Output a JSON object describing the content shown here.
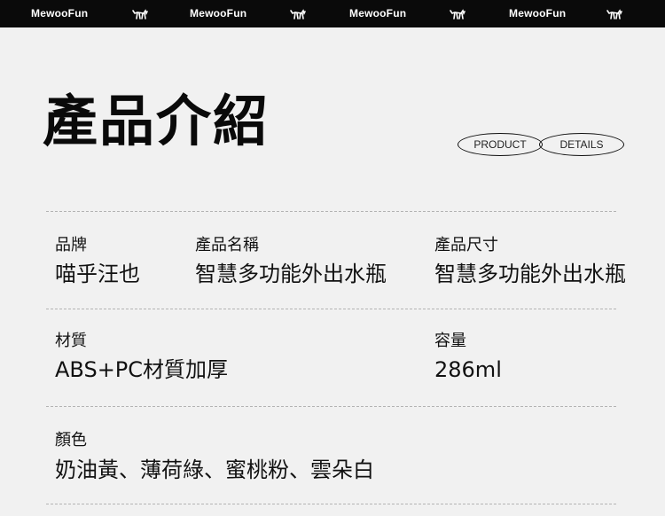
{
  "header": {
    "brand_items": [
      "MewooFun",
      "MewooFun",
      "MewooFun",
      "MewooFun"
    ],
    "icon": "cat-icon"
  },
  "title": "產品介紹",
  "pills": {
    "left": "PRODUCT",
    "right": "DETAILS"
  },
  "specs": {
    "brand": {
      "label": "品牌",
      "value": "喵乎汪也"
    },
    "product_name": {
      "label": "產品名稱",
      "value": "智慧多功能外出水瓶"
    },
    "size": {
      "label": "產品尺寸",
      "value": "智慧多功能外出水瓶"
    },
    "material": {
      "label": "材質",
      "value": "ABS+PC材質加厚"
    },
    "capacity": {
      "label": "容量",
      "value": "286ml"
    },
    "colors": {
      "label": "顏色",
      "value": "奶油黃、薄荷綠、蜜桃粉、雲朵白"
    }
  },
  "colors": {
    "background": "#f1f1f1",
    "bar": "#0a0a0a",
    "text": "#111111",
    "divider": "#b3b3b3"
  }
}
